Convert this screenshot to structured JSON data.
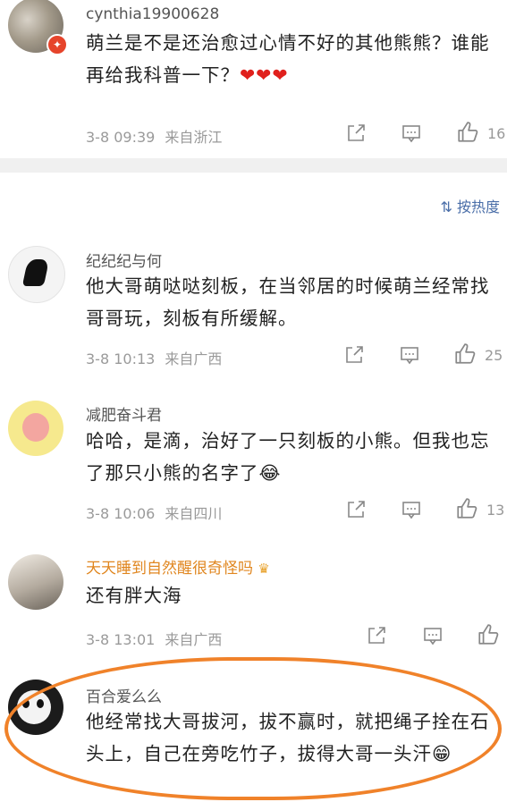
{
  "sort_label": "按热度",
  "comments": [
    {
      "username": "cynthia19900628",
      "text": "萌兰是不是还治愈过心情不好的其他熊熊？谁能再给我科普一下？",
      "emoji": "❤❤❤",
      "date": "3-8 09:39",
      "source": "来自浙江",
      "likes": "16"
    },
    {
      "username": "纪纪纪与何",
      "text": "他大哥萌哒哒刻板，在当邻居的时候萌兰经常找哥哥玩，刻板有所缓解。",
      "date": "3-8 10:13",
      "source": "来自广西",
      "likes": "25"
    },
    {
      "username": "减肥奋斗君",
      "text": "哈哈，是滴，治好了一只刻板的小熊。但我也忘了那只小熊的名字了😂",
      "date": "3-8 10:06",
      "source": "来自四川",
      "likes": "13"
    },
    {
      "username": "天天睡到自然醒很奇怪吗",
      "text": "还有胖大海",
      "date": "3-8 13:01",
      "source": "来自广西",
      "likes": ""
    },
    {
      "username": "百合爱么么",
      "text": "他经常找大哥拔河，拔不赢时，就把绳子拴在石头上，自己在旁吃竹子，拔得大哥一头汗😁"
    }
  ]
}
